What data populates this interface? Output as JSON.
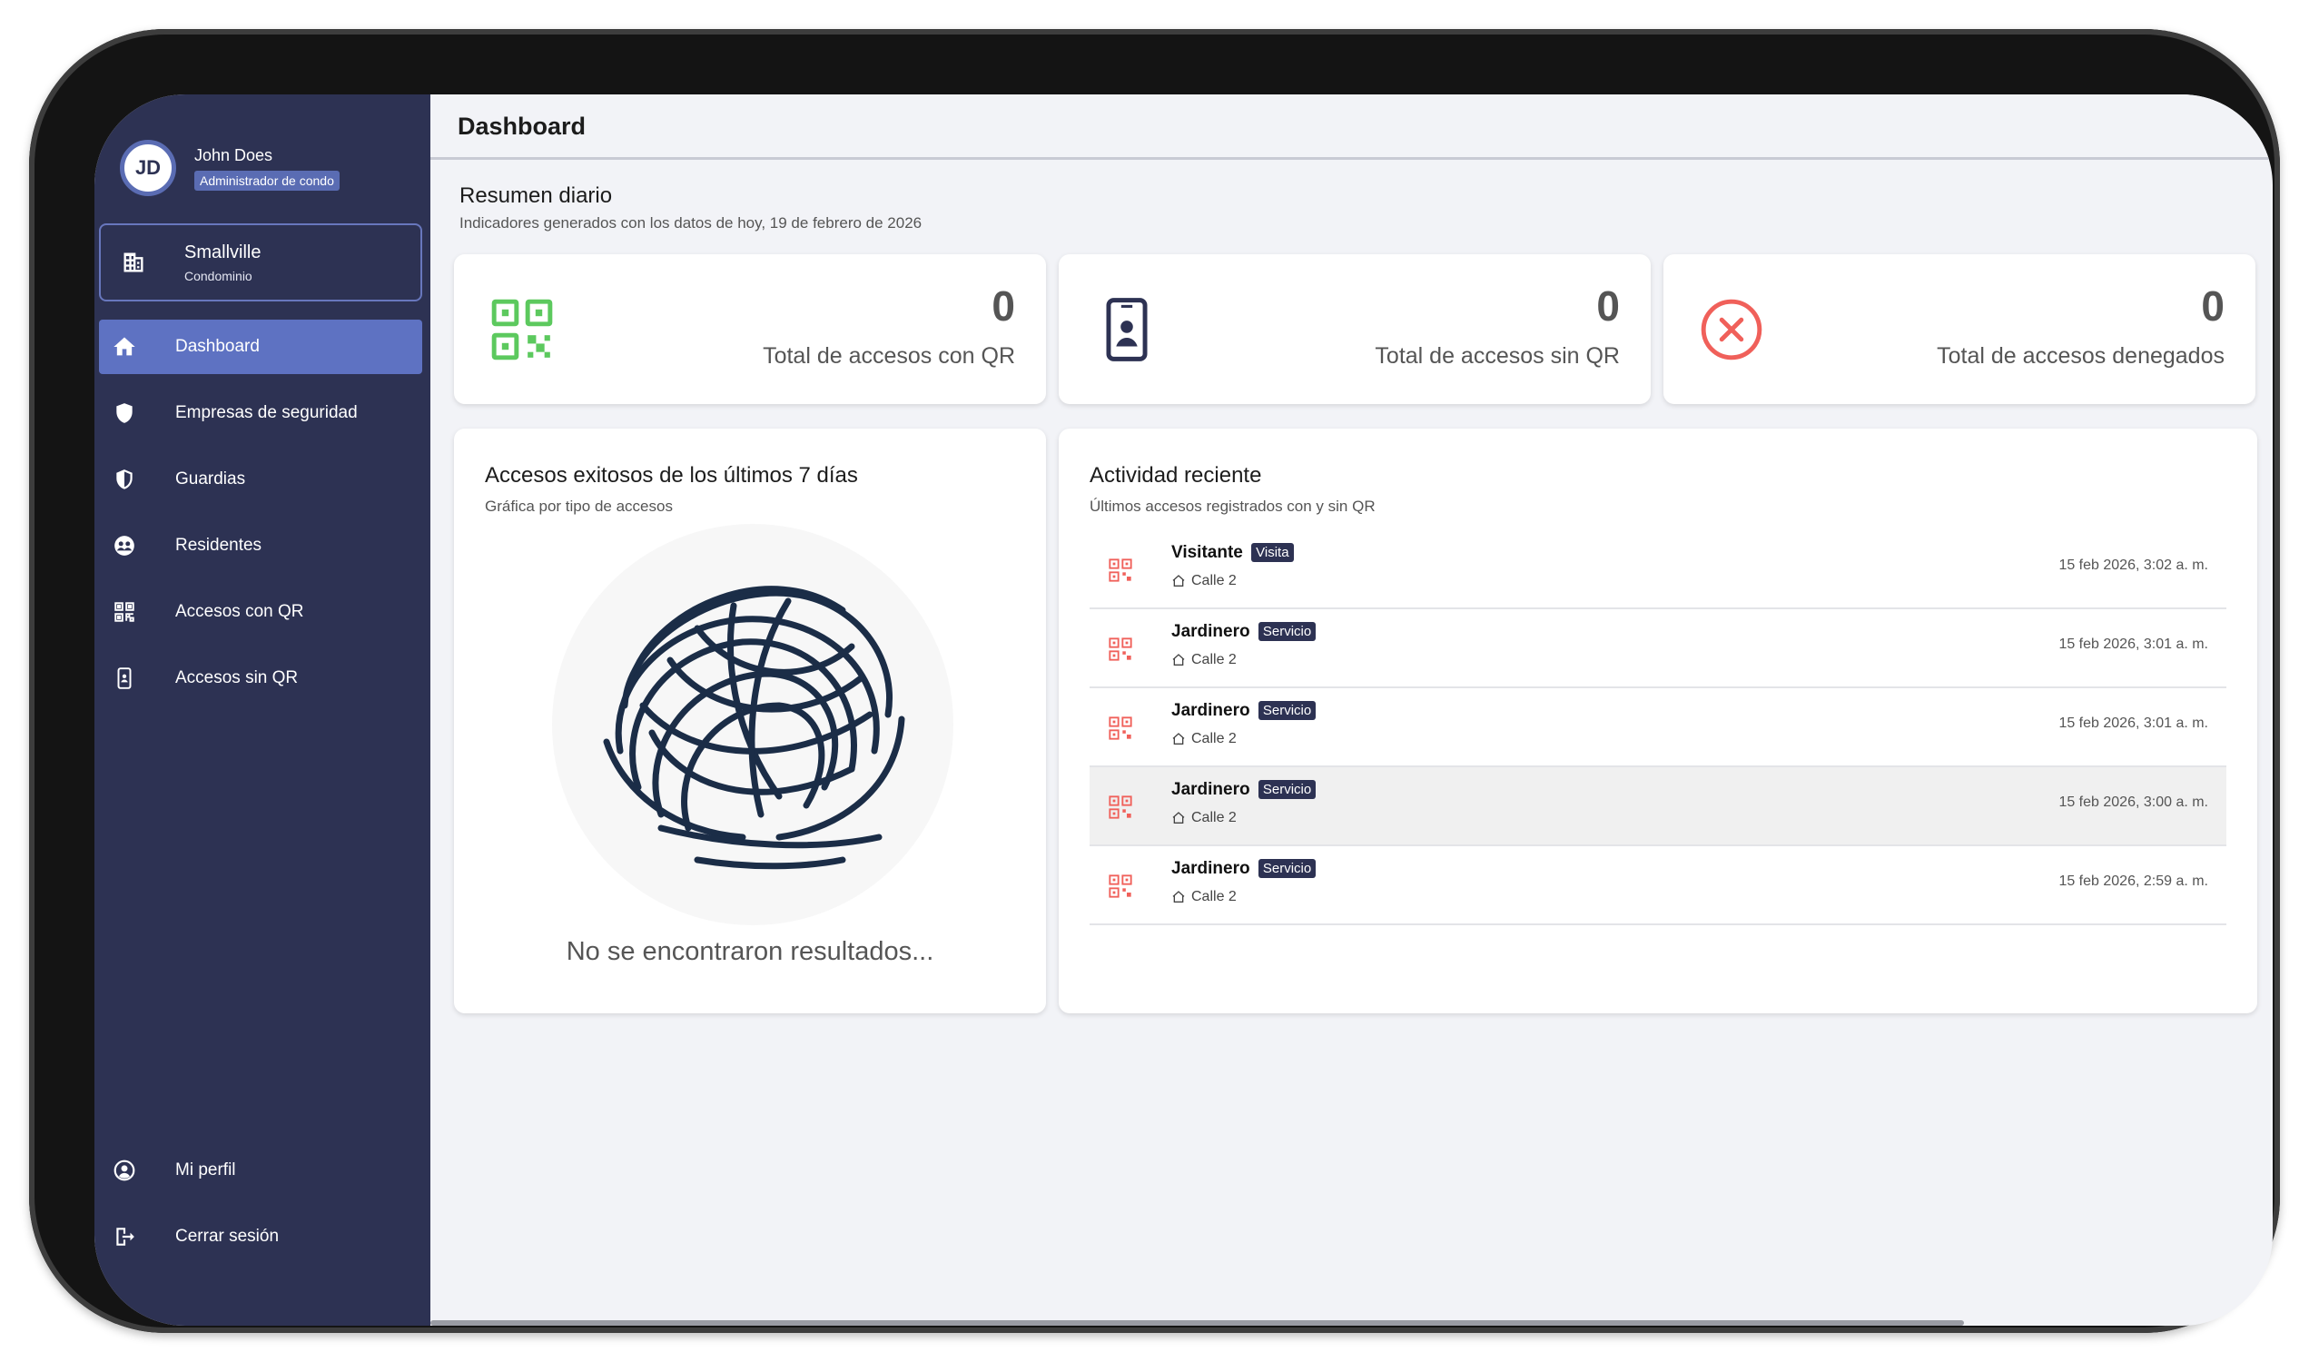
{
  "user": {
    "initials": "JD",
    "name": "John Does",
    "role": "Administrador de condo"
  },
  "condo": {
    "name": "Smallville",
    "type": "Condominio"
  },
  "nav": {
    "items": [
      {
        "label": "Dashboard",
        "icon": "home-icon",
        "active": true
      },
      {
        "label": "Empresas de seguridad",
        "icon": "shield-icon"
      },
      {
        "label": "Guardias",
        "icon": "half-shield-icon"
      },
      {
        "label": "Residentes",
        "icon": "residents-icon"
      },
      {
        "label": "Accesos con QR",
        "icon": "qr-icon"
      },
      {
        "label": "Accesos sin QR",
        "icon": "phone-icon"
      }
    ],
    "bottom": [
      {
        "label": "Mi perfil",
        "icon": "user-circle-icon"
      },
      {
        "label": "Cerrar sesión",
        "icon": "logout-icon"
      }
    ]
  },
  "header": {
    "title": "Dashboard"
  },
  "summary": {
    "title": "Resumen diario",
    "subtitle": "Indicadores generados con los datos de hoy, 19 de febrero de 2026"
  },
  "stats": [
    {
      "value": "0",
      "label": "Total de accesos con QR",
      "icon": "qr-icon",
      "color": "#5cc95e"
    },
    {
      "value": "0",
      "label": "Total de accesos sin QR",
      "icon": "phone-badge-icon",
      "color": "#2d3253"
    },
    {
      "value": "0",
      "label": "Total de accesos denegados",
      "icon": "cancel-circle-icon",
      "color": "#f0605a"
    }
  ],
  "chart_panel": {
    "title": "Accesos exitosos de los últimos 7 días",
    "subtitle": "Gráfica por tipo de accesos",
    "empty_text": "No se encontraron resultados..."
  },
  "activity": {
    "title": "Actividad reciente",
    "subtitle": "Últimos accesos registrados con y sin QR",
    "rows": [
      {
        "name": "Visitante",
        "badge": "Visita",
        "address": "Calle 2",
        "time": "15 feb 2026, 3:02 a. m."
      },
      {
        "name": "Jardinero",
        "badge": "Servicio",
        "address": "Calle 2",
        "time": "15 feb 2026, 3:01 a. m."
      },
      {
        "name": "Jardinero",
        "badge": "Servicio",
        "address": "Calle 2",
        "time": "15 feb 2026, 3:01 a. m."
      },
      {
        "name": "Jardinero",
        "badge": "Servicio",
        "address": "Calle 2",
        "time": "15 feb 2026, 3:00 a. m."
      },
      {
        "name": "Jardinero",
        "badge": "Servicio",
        "address": "Calle 2",
        "time": "15 feb 2026, 2:59 a. m."
      }
    ],
    "highlight_index": 3
  }
}
